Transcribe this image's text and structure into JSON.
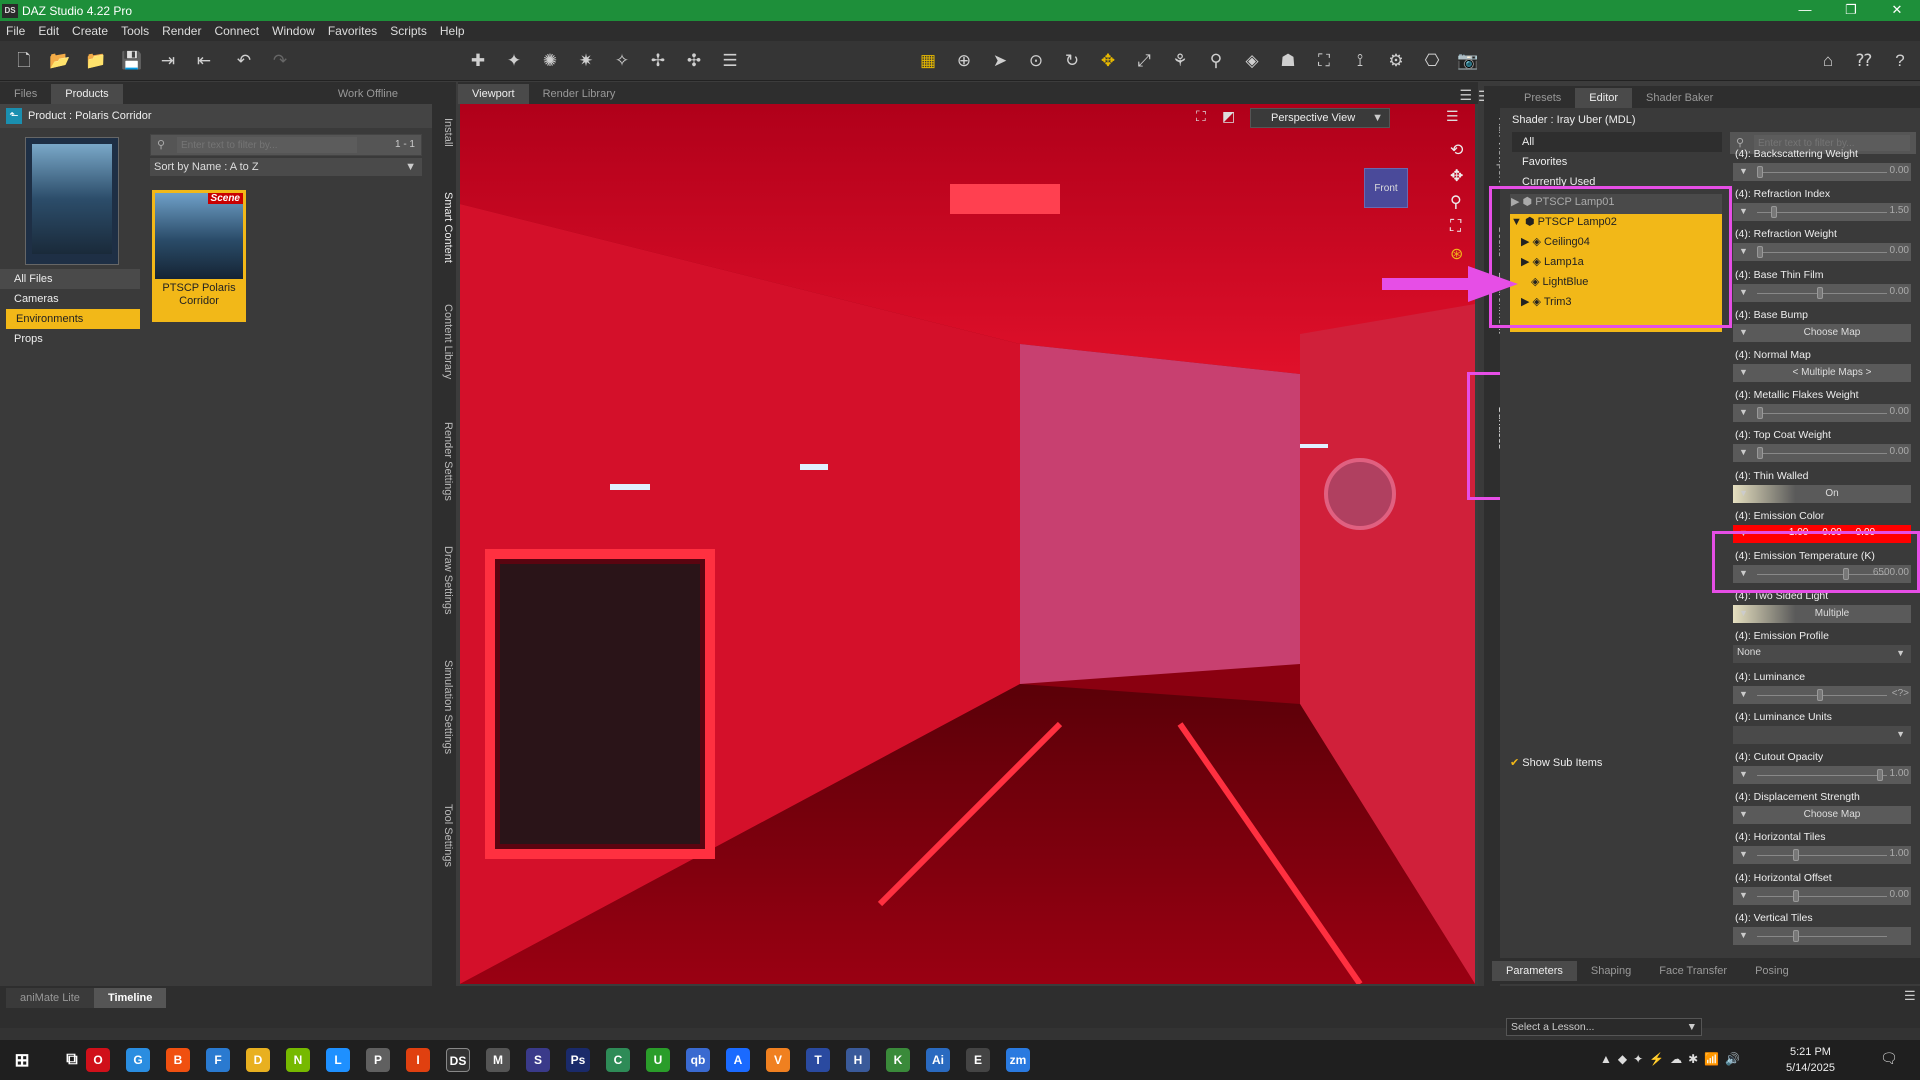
{
  "window": {
    "title": "DAZ Studio 4.22 Pro",
    "app_icon": "DS",
    "minimize": "—",
    "restore": "❐",
    "close": "✕"
  },
  "menu": [
    "File",
    "Edit",
    "Create",
    "Tools",
    "Render",
    "Connect",
    "Window",
    "Favorites",
    "Scripts",
    "Help"
  ],
  "left_panel": {
    "tabs": [
      "Files",
      "Products"
    ],
    "work_offline": "Work Offline",
    "product_label": "Product : Polaris Corridor",
    "search_placeholder": "Enter text to filter by...",
    "page_count": "1 - 1",
    "sort": "Sort by Name : A to Z",
    "categories": [
      "All Files",
      "Cameras",
      "Environments",
      "Props"
    ],
    "selected_category": "Environments",
    "item": {
      "badge": "Scene",
      "name": "PTSCP Polaris Corridor"
    },
    "side_tabs": [
      "Install",
      "Smart Content",
      "Content Library",
      "Render Settings",
      "Draw Settings",
      "Simulation Settings",
      "Tool Settings"
    ]
  },
  "viewport": {
    "tabs": [
      "Viewport",
      "Render Library"
    ],
    "view_mode": "Perspective View",
    "cube_label": "Front"
  },
  "right_side_tabs": [
    "Aux Viewport",
    "Scene",
    "Environment",
    "Surfaces"
  ],
  "right_panel": {
    "tabs": [
      "Presets",
      "Editor",
      "Shader Baker"
    ],
    "shader": "Shader : Iray Uber (MDL)",
    "filters": [
      "All",
      "Favorites",
      "Currently Used"
    ],
    "search_placeholder": "Enter text to filter by...",
    "tree": [
      {
        "label": "PTSCP Lamp01",
        "level": 0
      },
      {
        "label": "PTSCP Lamp02",
        "level": 0
      },
      {
        "label": "Ceiling04",
        "level": 1
      },
      {
        "label": "Lamp1a",
        "level": 1
      },
      {
        "label": "LightBlue",
        "level": 1
      },
      {
        "label": "Trim3",
        "level": 1
      }
    ],
    "show_sub_items": "Show Sub Items",
    "params": [
      {
        "label": "(4): Backscattering Weight",
        "type": "slider",
        "value": "0.00",
        "pos": 0.0
      },
      {
        "label": "(4): Refraction Index",
        "type": "slider",
        "value": "1.50",
        "pos": 0.12
      },
      {
        "label": "(4): Refraction Weight",
        "type": "slider",
        "value": "0.00",
        "pos": 0.0
      },
      {
        "label": "(4): Base Thin Film",
        "type": "slider",
        "value": "0.00",
        "pos": 0.5
      },
      {
        "label": "(4): Base Bump",
        "type": "button",
        "value": "Choose Map"
      },
      {
        "label": "(4): Normal Map",
        "type": "button",
        "value": "< Multiple Maps >"
      },
      {
        "label": "(4): Metallic Flakes Weight",
        "type": "slider",
        "value": "0.00",
        "pos": 0.0
      },
      {
        "label": "(4): Top Coat Weight",
        "type": "slider",
        "value": "0.00",
        "pos": 0.0
      },
      {
        "label": "(4): Thin Walled",
        "type": "toggle",
        "value": "On"
      },
      {
        "label": "(4): Emission Color",
        "type": "color",
        "value": "1.00     0.00     0.00"
      },
      {
        "label": "(4): Emission Temperature (K)",
        "type": "slider",
        "value": "6500.00",
        "pos": 0.72
      },
      {
        "label": "(4): Two Sided Light",
        "type": "toggle",
        "value": "Multiple"
      },
      {
        "label": "(4): Emission Profile",
        "type": "select",
        "value": "None"
      },
      {
        "label": "(4): Luminance",
        "type": "slider",
        "value": "<?>",
        "pos": 0.5
      },
      {
        "label": "(4): Luminance Units",
        "type": "select",
        "value": ""
      },
      {
        "label": "(4): Cutout Opacity",
        "type": "slider",
        "value": "1.00",
        "pos": 1.0
      },
      {
        "label": "(4): Displacement Strength",
        "type": "button",
        "value": "Choose Map"
      },
      {
        "label": "(4): Horizontal Tiles",
        "type": "slider",
        "value": "1.00",
        "pos": 0.3
      },
      {
        "label": "(4): Horizontal Offset",
        "type": "slider",
        "value": "0.00",
        "pos": 0.3
      },
      {
        "label": "(4): Vertical Tiles",
        "type": "slider",
        "value": "",
        "pos": 0.3
      }
    ],
    "bottom_tabs": [
      "Parameters",
      "Shaping",
      "Face Transfer",
      "Posing"
    ]
  },
  "bottom_tabs": [
    "aniMate Lite",
    "Timeline"
  ],
  "lesson_select": "Select a Lesson...",
  "taskbar": {
    "time": "5:21 PM",
    "date": "5/14/2025",
    "apps": [
      "O",
      "G",
      "B",
      "F",
      "D",
      "N",
      "L",
      "P",
      "I",
      "DS",
      "M",
      "S",
      "Ps",
      "C",
      "U",
      "qb",
      "A",
      "V",
      "T",
      "H",
      "K",
      "Ai",
      "E",
      "zm"
    ]
  },
  "colors": {
    "accent": "#f2b818",
    "title_bar": "#1e8f3a",
    "highlight": "#e64ee6",
    "emission_red": "#ff0000"
  }
}
